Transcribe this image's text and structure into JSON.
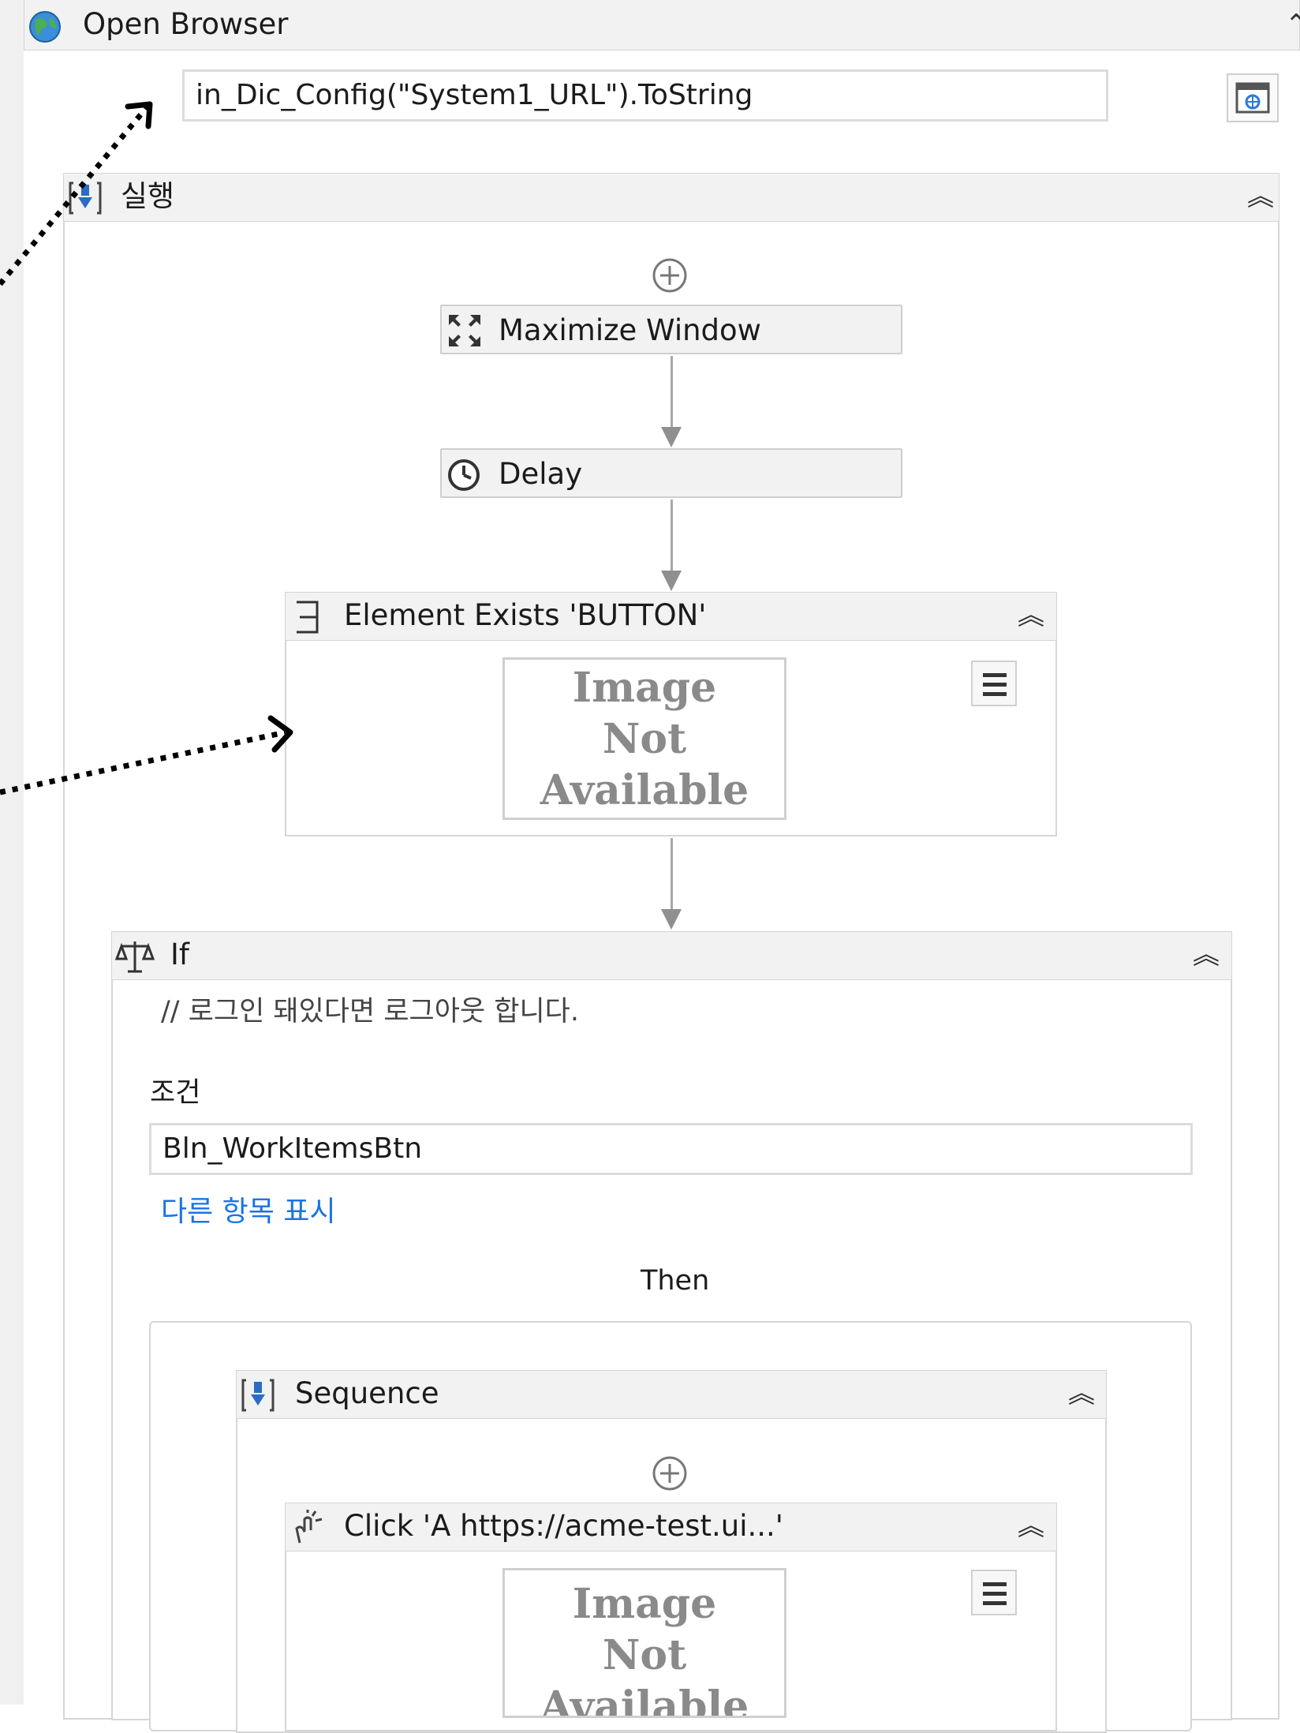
{
  "open_browser": {
    "title": "Open Browser",
    "url_value": "in_Dic_Config(\"System1_URL\").ToString"
  },
  "do_sequence": {
    "title": "실행"
  },
  "maximize_window": {
    "title": "Maximize Window"
  },
  "delay": {
    "title": "Delay"
  },
  "element_exists": {
    "title": "Element Exists 'BUTTON'",
    "image_placeholder": [
      "Image",
      "Not",
      "Available"
    ]
  },
  "if_activity": {
    "title": "If",
    "annotation": "// 로그인 돼있다면 로그아웃 합니다.",
    "condition_label": "조건",
    "condition_value": "Bln_WorkItemsBtn",
    "show_more_link": "다른 항목 표시",
    "then_label": "Then"
  },
  "sequence": {
    "title": "Sequence"
  },
  "click": {
    "title": "Click 'A  https://acme-test.ui...'",
    "image_placeholder": [
      "Image",
      "Not",
      "Available"
    ]
  },
  "icons": {
    "open_browser": "globe-icon",
    "sequence": "sequence-icon",
    "maximize": "maximize-icon",
    "delay": "clock-icon",
    "element_exists": "exists-icon",
    "if": "scale-icon",
    "click": "click-icon",
    "collapse": "double-chevron-up-icon",
    "add": "plus-circle-icon",
    "menu": "hamburger-icon",
    "browser_picker": "browser-window-icon"
  },
  "colors": {
    "link": "#1a73e8",
    "header_bg": "#f2f2f2",
    "connector": "#a8a8a8",
    "annotation_arrow": "#000000"
  }
}
